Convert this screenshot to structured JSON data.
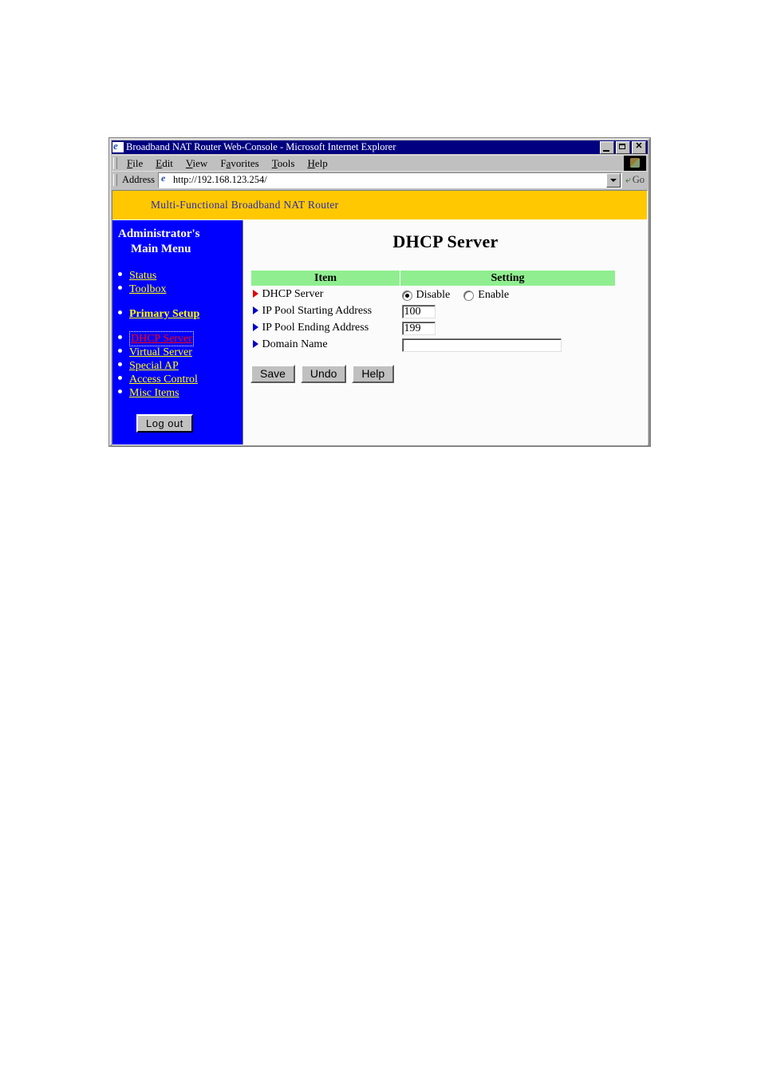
{
  "window": {
    "title": "Broadband NAT Router Web-Console - Microsoft Internet Explorer",
    "minimize_label": "",
    "maximize_label": "",
    "close_label": "✕"
  },
  "menubar": {
    "items": [
      {
        "label": "File",
        "accel": "F"
      },
      {
        "label": "Edit",
        "accel": "E"
      },
      {
        "label": "View",
        "accel": "V"
      },
      {
        "label": "Favorites",
        "accel": "a"
      },
      {
        "label": "Tools",
        "accel": "T"
      },
      {
        "label": "Help",
        "accel": "H"
      }
    ]
  },
  "addressbar": {
    "label": "Address",
    "url": "http://192.168.123.254/",
    "go_label": "Go"
  },
  "banner": {
    "text": "Multi-Functional Broadband NAT Router"
  },
  "sidebar": {
    "title_line1": "Administrator's",
    "title_line2": "Main Menu",
    "group1": [
      {
        "label": "Status",
        "state": "normal"
      },
      {
        "label": "Toolbox",
        "state": "normal"
      }
    ],
    "group2": [
      {
        "label": "Primary Setup",
        "state": "bold"
      }
    ],
    "group3": [
      {
        "label": "DHCP Server",
        "state": "active"
      },
      {
        "label": "Virtual Server",
        "state": "normal"
      },
      {
        "label": "Special AP",
        "state": "normal"
      },
      {
        "label": "Access Control",
        "state": "normal"
      },
      {
        "label": "Misc Items",
        "state": "normal"
      }
    ],
    "logout_label": "Log out"
  },
  "main": {
    "page_title": "DHCP Server",
    "table": {
      "headers": [
        "Item",
        "Setting"
      ],
      "rows": [
        {
          "label": "DHCP Server",
          "bullet": "red",
          "type": "radio",
          "options": [
            {
              "label": "Disable",
              "selected": true
            },
            {
              "label": "Enable",
              "selected": false
            }
          ]
        },
        {
          "label": "IP Pool Starting Address",
          "bullet": "blue",
          "type": "text",
          "value": "100",
          "size": "small"
        },
        {
          "label": "IP Pool Ending Address",
          "bullet": "blue",
          "type": "text",
          "value": "199",
          "size": "small"
        },
        {
          "label": "Domain Name",
          "bullet": "blue",
          "type": "text",
          "value": "",
          "size": "large"
        }
      ]
    },
    "buttons": [
      {
        "label": "Save"
      },
      {
        "label": "Undo"
      },
      {
        "label": "Help"
      }
    ]
  },
  "colors": {
    "banner_bg": "#ffc800",
    "banner_fg": "#2a2ab0",
    "sidebar_bg": "#0000ff",
    "link": "#ffff00",
    "active_link": "#ff0000",
    "table_header_bg": "#90ee90",
    "titlebar_bg": "#000080"
  }
}
